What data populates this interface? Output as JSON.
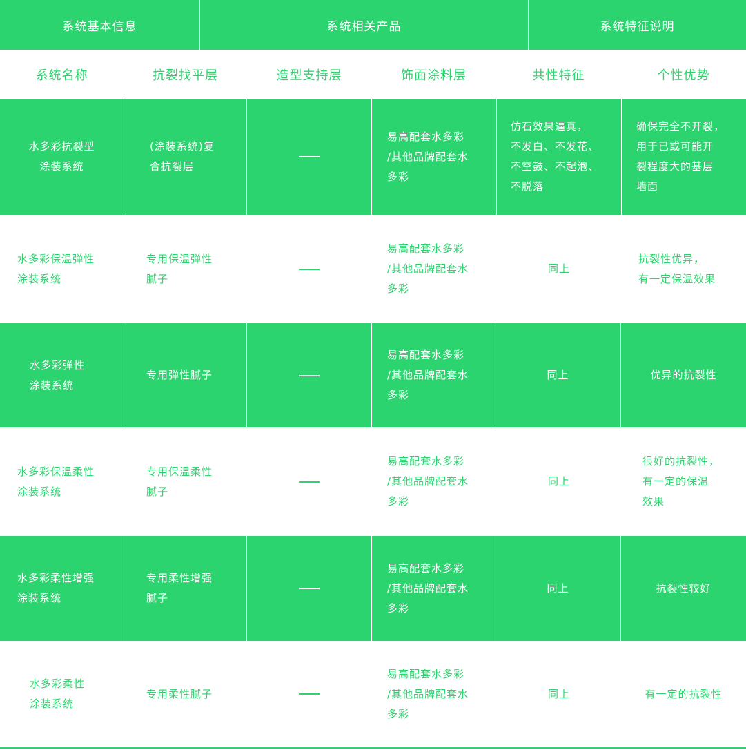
{
  "header": {
    "groups": [
      "系统基本信息",
      "系统相关产品",
      "系统特征说明"
    ],
    "columns": [
      "系统名称",
      "抗裂找平层",
      "造型支持层",
      "饰面涂料层",
      "共性特征",
      "个性优势"
    ]
  },
  "rows": [
    {
      "name": "水多彩抗裂型\n涂装系统",
      "leveling": "(涂装系统)复\n合抗裂层",
      "finish": "易高配套水多彩\n/其他品牌配套水\n多彩",
      "common": "仿石效果逼真，\n不发白、不发花、\n不空鼓、不起泡、\n不脱落",
      "advantage": "确保完全不开裂，\n用于已或可能开\n裂程度大的基层\n墙面"
    },
    {
      "name": "水多彩保温弹性\n涂装系统",
      "leveling": "专用保温弹性\n腻子",
      "finish": "易高配套水多彩\n/其他品牌配套水\n多彩",
      "common": "同上",
      "advantage": "抗裂性优异，\n有一定保温效果"
    },
    {
      "name": "水多彩弹性\n涂装系统",
      "leveling": "专用弹性腻子",
      "finish": "易高配套水多彩\n/其他品牌配套水\n多彩",
      "common": "同上",
      "advantage": "优异的抗裂性"
    },
    {
      "name": "水多彩保温柔性\n涂装系统",
      "leveling": "专用保温柔性\n腻子",
      "finish": "易高配套水多彩\n/其他品牌配套水\n多彩",
      "common": "同上",
      "advantage": "很好的抗裂性，\n有一定的保温\n效果"
    },
    {
      "name": "水多彩柔性增强\n涂装系统",
      "leveling": "专用柔性增强\n腻子",
      "finish": "易高配套水多彩\n/其他品牌配套水\n多彩",
      "common": "同上",
      "advantage": "抗裂性较好"
    },
    {
      "name": "水多彩柔性\n涂装系统",
      "leveling": "专用柔性腻子",
      "finish": "易高配套水多彩\n/其他品牌配套水\n多彩",
      "common": "同上",
      "advantage": "有一定的抗裂性"
    }
  ],
  "colors": {
    "accent": "#2bd46e",
    "background": "#ffffff"
  }
}
